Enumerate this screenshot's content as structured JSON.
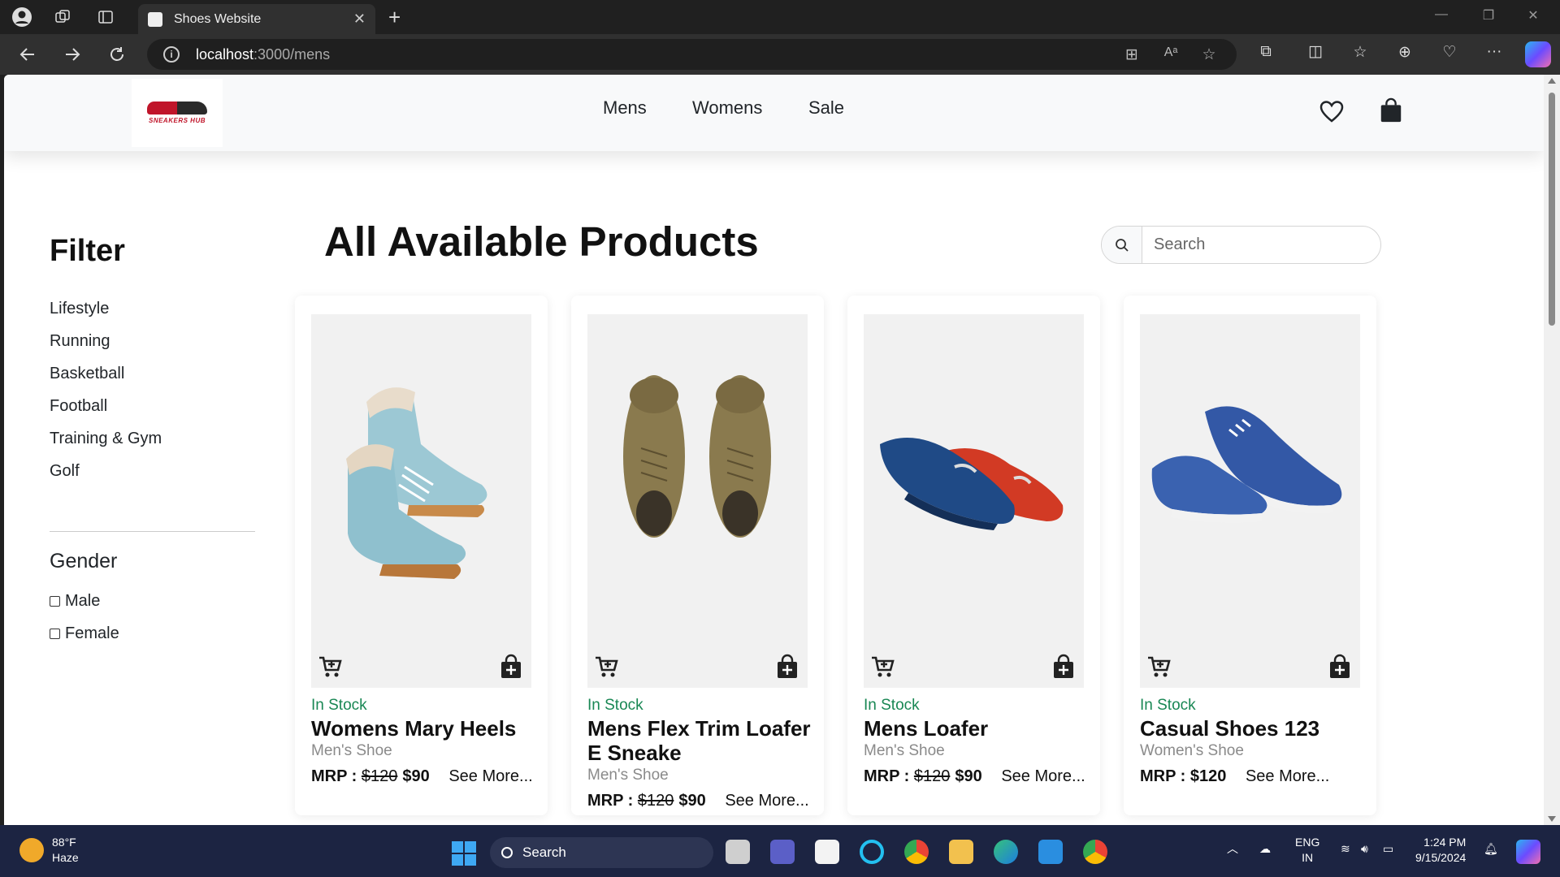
{
  "browser": {
    "tab_title": "Shoes Website",
    "url_host": "localhost",
    "url_path": ":3000/mens"
  },
  "header": {
    "logo_text": "SNEAKERS HUB",
    "nav": [
      "Mens",
      "Womens",
      "Sale"
    ]
  },
  "sidebar": {
    "title": "Filter",
    "categories": [
      "Lifestyle",
      "Running",
      "Basketball",
      "Football",
      "Training & Gym",
      "Golf"
    ],
    "gender_title": "Gender",
    "genders": [
      "Male",
      "Female"
    ]
  },
  "main": {
    "title": "All Available Products",
    "search_placeholder": "Search"
  },
  "products": [
    {
      "stock": "In Stock",
      "name": "Womens Mary Heels",
      "category": "Men's Shoe",
      "mrp_label": "MRP :",
      "old_price": "$120",
      "price": "$90",
      "see_more": "See More..."
    },
    {
      "stock": "In Stock",
      "name": "Mens Flex Trim Loafer E Sneake",
      "category": "Men's Shoe",
      "mrp_label": "MRP :",
      "old_price": "$120",
      "price": "$90",
      "see_more": "See More..."
    },
    {
      "stock": "In Stock",
      "name": "Mens Loafer",
      "category": "Men's Shoe",
      "mrp_label": "MRP :",
      "old_price": "$120",
      "price": "$90",
      "see_more": "See More..."
    },
    {
      "stock": "In Stock",
      "name": "Casual Shoes 123",
      "category": "Women's Shoe",
      "mrp_label": "MRP :",
      "old_price": "",
      "price": "$120",
      "see_more": "See More..."
    }
  ],
  "taskbar": {
    "temp": "88°F",
    "weather": "Haze",
    "search_label": "Search",
    "lang": "ENG",
    "region": "IN",
    "time": "1:24 PM",
    "date": "9/15/2024"
  },
  "colors": {
    "in_stock": "#198754",
    "header_bg": "#f8f9fa",
    "taskbar_bg": "#1c2442"
  }
}
